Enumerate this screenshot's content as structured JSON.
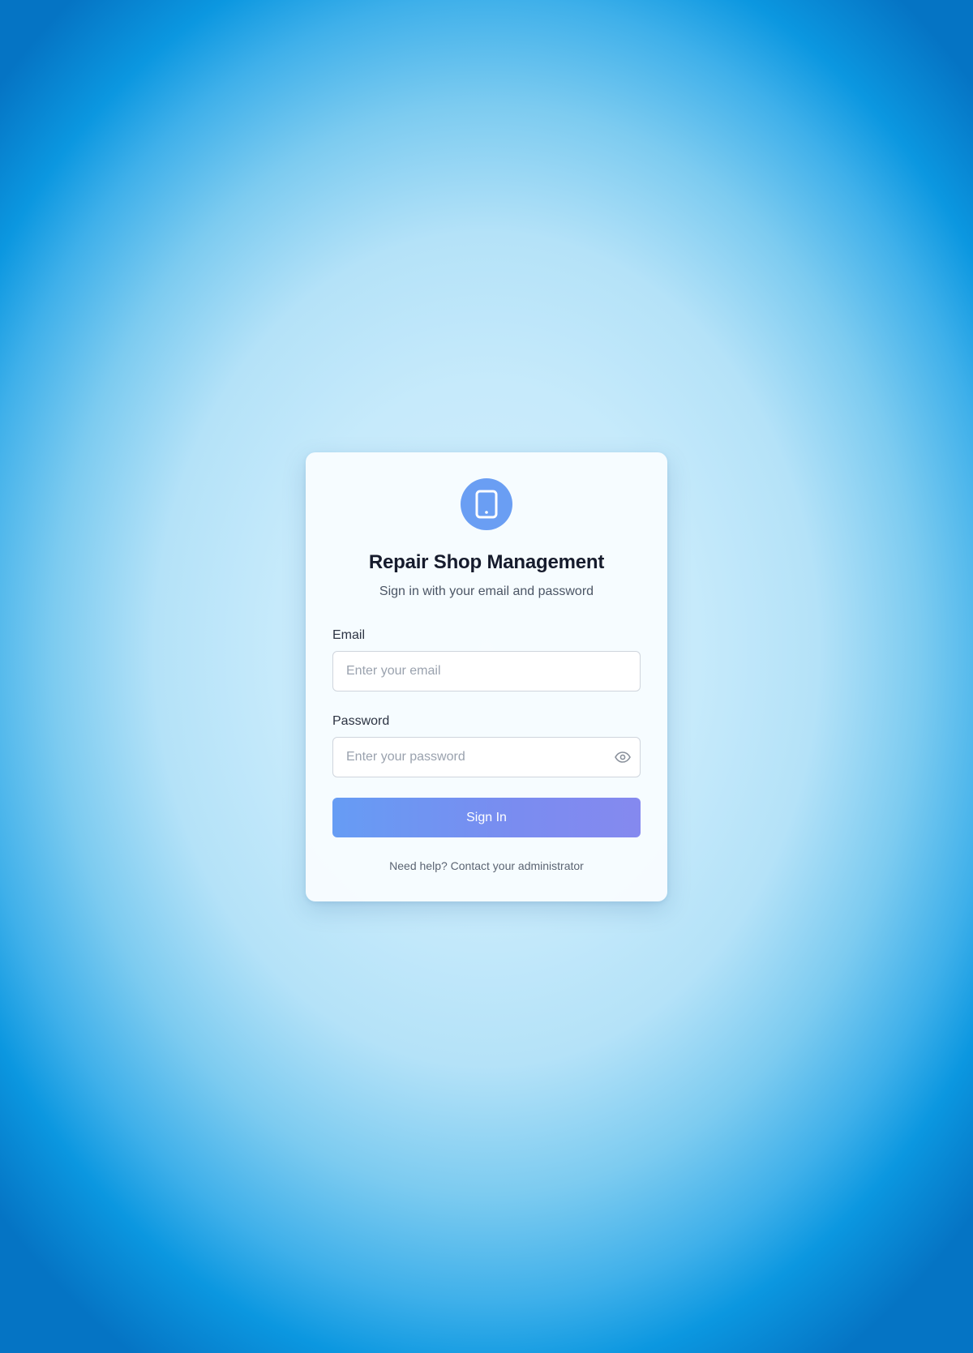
{
  "app": {
    "title": "Repair Shop Management",
    "subtitle": "Sign in with your email and password",
    "logo_icon": "tablet-icon"
  },
  "form": {
    "email": {
      "label": "Email",
      "value": "",
      "placeholder": "Enter your email"
    },
    "password": {
      "label": "Password",
      "value": "",
      "placeholder": "Enter your password",
      "toggle_icon": "eye-icon"
    },
    "submit_label": "Sign In"
  },
  "footer": {
    "help_text": "Need help? Contact your administrator"
  },
  "colors": {
    "accent": "#6a9ef3",
    "button_gradient_start": "#669cf4",
    "button_gradient_end": "#8589ef",
    "background_outer": "#0b97e0",
    "background_inner": "#d2eefc"
  }
}
